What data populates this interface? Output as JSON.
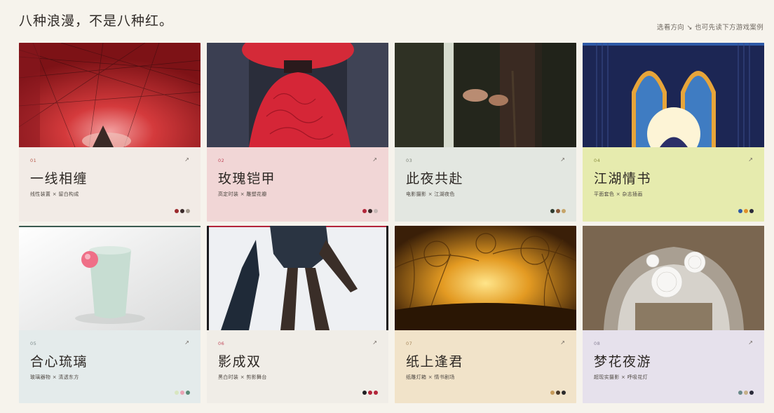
{
  "header": {
    "title": "八种浪漫，不是八种红。",
    "hint": "选看方向 ↘ 也可先读下方游戏案例"
  },
  "cards": [
    {
      "num": "01",
      "arrow": "↗",
      "name": "一线相缠",
      "desc": "线性装置 × 留白构成",
      "panel_color": "#f2ebe6",
      "num_color": "#b5584a",
      "palette": [
        "#9c2a2e",
        "#3a2b2b",
        "#a59b8f"
      ]
    },
    {
      "num": "02",
      "arrow": "↗",
      "name": "玫瑰铠甲",
      "desc": "高定时装 × 雕塑花瓣",
      "panel_color": "#f1d6d6",
      "num_color": "#c0485a",
      "palette": [
        "#b3253a",
        "#3a2b2b",
        "#c6b8b6"
      ]
    },
    {
      "num": "03",
      "arrow": "↗",
      "name": "此夜共赴",
      "desc": "电影摄影 × 江湖夜色",
      "panel_color": "#e3e7e1",
      "num_color": "#7d8378",
      "palette": [
        "#2d3a2e",
        "#8a5a3a",
        "#c6a56a"
      ]
    },
    {
      "num": "04",
      "arrow": "↗",
      "name": "江湖情书",
      "desc": "平面套色 × 杂志插画",
      "panel_color": "#e6ebae",
      "num_color": "#8a8f3e",
      "palette": [
        "#2e5aa8",
        "#e0902a",
        "#2b2b3a"
      ]
    },
    {
      "num": "05",
      "arrow": "↗",
      "name": "合心琉璃",
      "desc": "玻璃器物 × 清透东方",
      "panel_color": "#e4ebeb",
      "num_color": "#7d8a8a",
      "palette": [
        "#d8e6c0",
        "#e9a3b4",
        "#5a8a76"
      ]
    },
    {
      "num": "06",
      "arrow": "↗",
      "name": "影成双",
      "desc": "黑白时装 × 剪影舞台",
      "panel_color": "#f0ede7",
      "num_color": "#c0485a",
      "palette": [
        "#1f1f22",
        "#b3253a",
        "#b3253a"
      ]
    },
    {
      "num": "07",
      "arrow": "↗",
      "name": "纸上逢君",
      "desc": "纸雕灯箱 × 情书剧场",
      "panel_color": "#f1e3c9",
      "num_color": "#a8885c",
      "palette": [
        "#c69a5a",
        "#4a3a2a",
        "#2b2b2b"
      ]
    },
    {
      "num": "08",
      "arrow": "↗",
      "name": "梦花夜游",
      "desc": "超现实摄影 × 呼吸花灯",
      "panel_color": "#e6e1ec",
      "num_color": "#8a8398",
      "palette": [
        "#6a8a8a",
        "#c6b08a",
        "#2b2b3a"
      ]
    }
  ]
}
